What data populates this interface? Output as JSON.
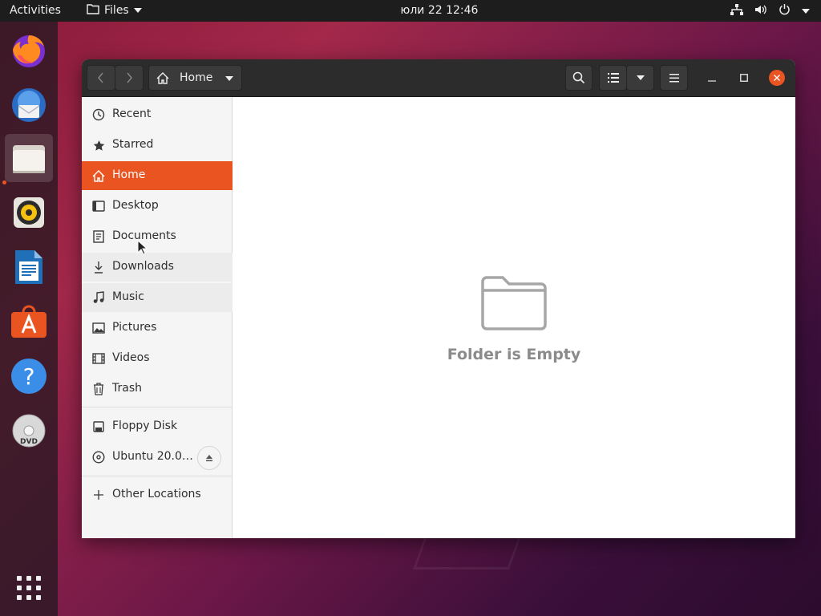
{
  "topbar": {
    "activities": "Activities",
    "app_name": "Files",
    "clock": "юли 22  12:46"
  },
  "dock": {
    "apps": [
      {
        "name": "Firefox Web Browser",
        "icon": "firefox-icon"
      },
      {
        "name": "Thunderbird Mail",
        "icon": "thunderbird-icon"
      },
      {
        "name": "Files",
        "icon": "files-icon",
        "running": true
      },
      {
        "name": "Rhythmbox",
        "icon": "rhythmbox-icon"
      },
      {
        "name": "LibreOffice Writer",
        "icon": "writer-icon"
      },
      {
        "name": "Ubuntu Software",
        "icon": "software-icon"
      },
      {
        "name": "Help",
        "icon": "help-icon"
      },
      {
        "name": "DVD",
        "icon": "dvd-icon",
        "label": "DVD"
      },
      {
        "name": "Show Applications",
        "icon": "app-grid-icon"
      }
    ]
  },
  "window": {
    "location": "Home",
    "sidebar": {
      "places": [
        {
          "label": "Recent",
          "icon": "clock-icon"
        },
        {
          "label": "Starred",
          "icon": "star-icon"
        },
        {
          "label": "Home",
          "icon": "home-icon",
          "selected": true
        },
        {
          "label": "Desktop",
          "icon": "desktop-icon"
        },
        {
          "label": "Documents",
          "icon": "document-icon"
        },
        {
          "label": "Downloads",
          "icon": "download-icon"
        },
        {
          "label": "Music",
          "icon": "music-icon"
        },
        {
          "label": "Pictures",
          "icon": "pictures-icon"
        },
        {
          "label": "Videos",
          "icon": "video-icon"
        },
        {
          "label": "Trash",
          "icon": "trash-icon"
        }
      ],
      "devices": [
        {
          "label": "Floppy Disk",
          "icon": "floppy-icon"
        },
        {
          "label": "Ubuntu 20.0…",
          "icon": "disc-icon",
          "ejectable": true
        }
      ],
      "other": {
        "label": "Other Locations",
        "icon": "plus-icon"
      }
    },
    "empty_message": "Folder is Empty"
  },
  "colors": {
    "accent": "#e95420",
    "headerbar": "#2c2c2c",
    "topbar": "#1d1d1d"
  }
}
